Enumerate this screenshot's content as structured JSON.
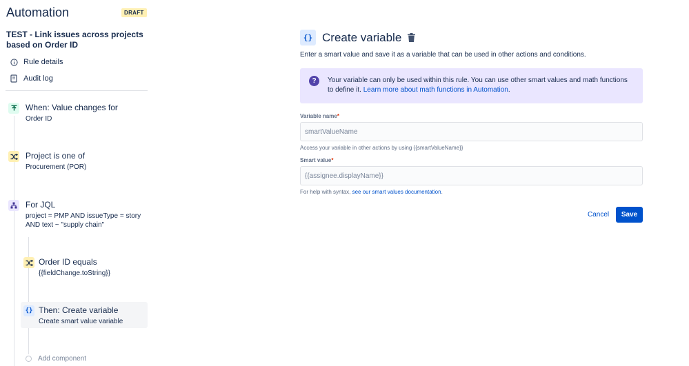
{
  "sidebar": {
    "app_title": "Automation",
    "status_badge": "DRAFT",
    "rule_name": "TEST - Link issues across projects based on Order ID",
    "links": {
      "rule_details": "Rule details",
      "audit_log": "Audit log"
    },
    "components": {
      "trigger": {
        "title": "When: Value changes for",
        "description": "Order ID",
        "icon": "trigger-icon"
      },
      "condition1": {
        "title": "Project is one of",
        "description": "Procurement (POR)",
        "icon": "shuffle-icon"
      },
      "branch": {
        "title": "For JQL",
        "description": "project = PMP AND issueType = story AND text ~ \"supply chain\"",
        "icon": "branch-icon"
      },
      "condition2": {
        "title": "Order ID equals",
        "description": "{{fieldChange.toString}}",
        "icon": "shuffle-icon"
      },
      "action": {
        "title": "Then: Create variable",
        "description": "Create smart value variable",
        "icon": "curly-braces-icon"
      }
    },
    "add_component": "Add component"
  },
  "main": {
    "title": "Create variable",
    "intro": "Enter a smart value and save it as a variable that can be used in other actions and conditions.",
    "info": {
      "text": "Your variable can only be used within this rule. You can use other smart values and math functions to define it.",
      "link": "Learn more about math functions in Automation",
      "suffix": "."
    },
    "variable_name": {
      "label": "Variable name",
      "placeholder": "smartValueName",
      "value": "",
      "help": "Access your variable in other actions by using {{smartValueName}}"
    },
    "smart_value": {
      "label": "Smart value",
      "placeholder": "{{assignee.displayName}}",
      "value": "",
      "help_prefix": "For help with syntax,",
      "help_link": "see our smart values documentation",
      "help_suffix": "."
    },
    "cancel_label": "Cancel",
    "save_label": "Save",
    "required_marker": "*"
  },
  "colors": {
    "primary": "#0052cc",
    "info_bg": "#eae6ff",
    "trigger_bg": "#dffcf0",
    "condition_bg": "#fff0b3",
    "branch_bg": "#eae6ff",
    "action_bg": "#deebff"
  }
}
